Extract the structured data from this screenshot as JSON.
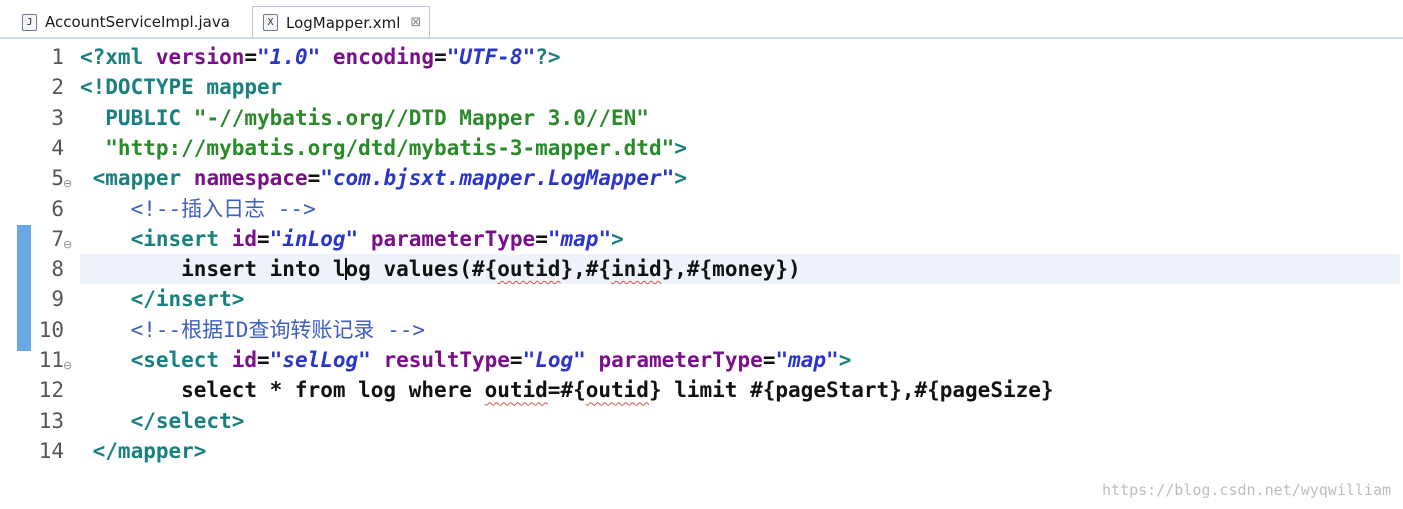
{
  "tabs": [
    {
      "label": "AccountServiceImpl.java",
      "icon": "java-file-icon",
      "icon_glyph": "J"
    },
    {
      "label": "LogMapper.xml",
      "icon": "xml-file-icon",
      "icon_glyph": "X",
      "close": "⊠"
    }
  ],
  "lines": [
    {
      "num": "1",
      "parts": [
        [
          "pi",
          "<?xml "
        ],
        [
          "attr",
          "version"
        ],
        [
          "txt",
          "="
        ],
        [
          "str",
          "\"1.0\""
        ],
        [
          "txt",
          " "
        ],
        [
          "attr",
          "encoding"
        ],
        [
          "txt",
          "="
        ],
        [
          "str",
          "\"UTF-8\""
        ],
        [
          "pi",
          "?>"
        ]
      ]
    },
    {
      "num": "2",
      "parts": [
        [
          "tag",
          "<!DOCTYPE mapper"
        ]
      ]
    },
    {
      "num": "3",
      "parts": [
        [
          "doctype",
          "  PUBLIC "
        ],
        [
          "dstr",
          "\"-//mybatis.org//DTD Mapper 3.0//EN\""
        ]
      ]
    },
    {
      "num": "4",
      "parts": [
        [
          "dstr",
          "  \"http://mybatis.org/dtd/mybatis-3-mapper.dtd\""
        ],
        [
          "tag",
          ">"
        ]
      ]
    },
    {
      "num": "5",
      "fold": true,
      "parts": [
        [
          "tag",
          " <mapper "
        ],
        [
          "attr",
          "namespace"
        ],
        [
          "txt",
          "="
        ],
        [
          "str",
          "\"com.bjsxt.mapper.LogMapper\""
        ],
        [
          "tag",
          ">"
        ]
      ]
    },
    {
      "num": "6",
      "parts": [
        [
          "com",
          "    <!--插入日志 -->"
        ]
      ]
    },
    {
      "num": "7",
      "fold": true,
      "parts": [
        [
          "tag",
          "    <insert "
        ],
        [
          "attr",
          "id"
        ],
        [
          "txt",
          "="
        ],
        [
          "str",
          "\"inLog\""
        ],
        [
          "txt",
          " "
        ],
        [
          "attr",
          "parameterType"
        ],
        [
          "txt",
          "="
        ],
        [
          "str",
          "\"map\""
        ],
        [
          "tag",
          ">"
        ]
      ]
    },
    {
      "num": "8",
      "current": true,
      "parts": [
        [
          "txt",
          "        insert into l"
        ],
        [
          "caret",
          ""
        ],
        [
          "txt",
          "og values(#{"
        ],
        [
          "sq",
          "outid"
        ],
        [
          "txt",
          "},#{"
        ],
        [
          "sq",
          "inid"
        ],
        [
          "txt",
          "},#{money})"
        ]
      ]
    },
    {
      "num": "9",
      "parts": [
        [
          "tag",
          "    </insert>"
        ]
      ]
    },
    {
      "num": "10",
      "parts": [
        [
          "com",
          "    <!--根据ID查询转账记录 -->"
        ]
      ]
    },
    {
      "num": "11",
      "fold": true,
      "parts": [
        [
          "tag",
          "    <select "
        ],
        [
          "attr",
          "id"
        ],
        [
          "txt",
          "="
        ],
        [
          "str",
          "\"selLog\""
        ],
        [
          "txt",
          " "
        ],
        [
          "attr",
          "resultType"
        ],
        [
          "txt",
          "="
        ],
        [
          "str",
          "\"Log\""
        ],
        [
          "txt",
          " "
        ],
        [
          "attr",
          "parameterType"
        ],
        [
          "txt",
          "="
        ],
        [
          "str",
          "\"map\""
        ],
        [
          "tag",
          ">"
        ]
      ]
    },
    {
      "num": "12",
      "parts": [
        [
          "txt",
          "        select * from log where "
        ],
        [
          "sq",
          "outid"
        ],
        [
          "txt",
          "=#{"
        ],
        [
          "sq",
          "outid"
        ],
        [
          "txt",
          "} limit #{pageStart},#{pageSize}"
        ]
      ]
    },
    {
      "num": "13",
      "parts": [
        [
          "tag",
          "    </select>"
        ]
      ]
    },
    {
      "num": "14",
      "parts": [
        [
          "tag",
          " </mapper>"
        ]
      ]
    }
  ],
  "watermark": "https://blog.csdn.net/wyqwilliam",
  "colors": {
    "tag": "#1a7f7f",
    "attribute": "#7a0f8a",
    "string": "#2a35c9",
    "doctype_string": "#2a8a2a",
    "comment": "#3f5fbf",
    "ruler_marker": "#6aa9e6"
  }
}
